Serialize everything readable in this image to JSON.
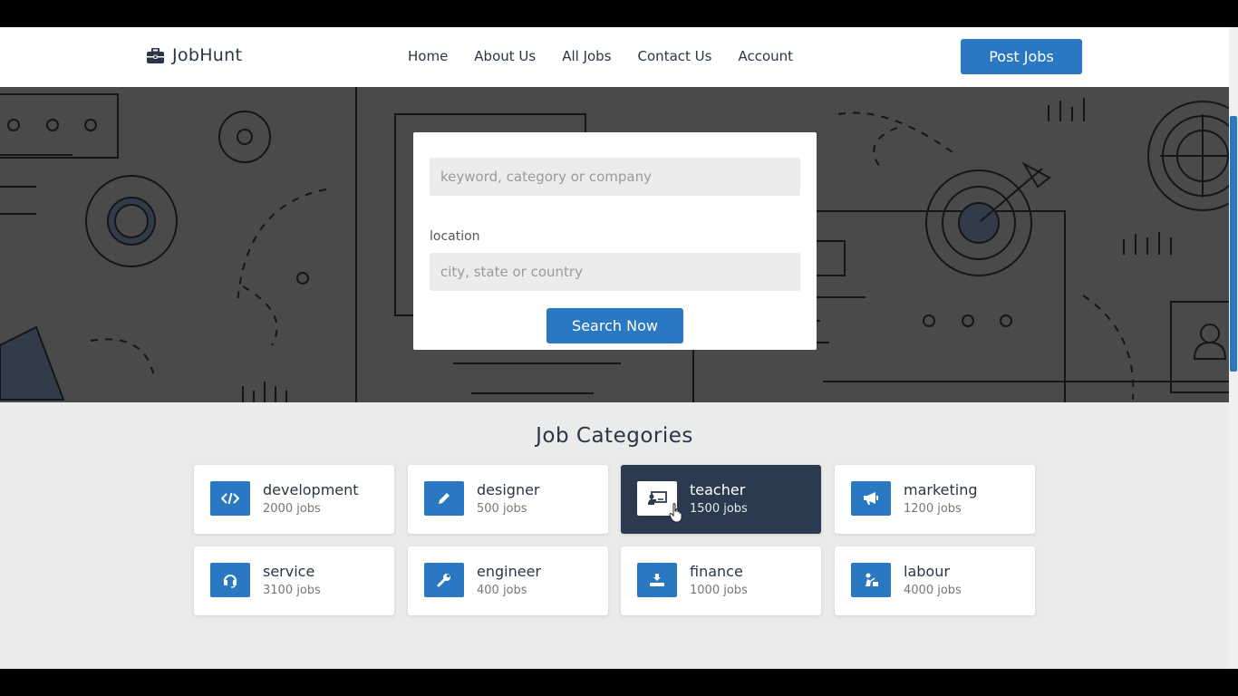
{
  "brand": {
    "name": "JobHunt",
    "icon": "briefcase-icon"
  },
  "nav": {
    "links": [
      "Home",
      "About Us",
      "All Jobs",
      "Contact Us",
      "Account"
    ],
    "post_button": "Post Jobs"
  },
  "search": {
    "keyword_placeholder": "keyword, category or company",
    "location_label": "location",
    "location_placeholder": "city, state or country",
    "button": "Search Now"
  },
  "categories": {
    "title": "Job Categories",
    "items": [
      {
        "name": "development",
        "count": "2000 jobs",
        "icon": "code-icon"
      },
      {
        "name": "designer",
        "count": "500 jobs",
        "icon": "pencil-icon"
      },
      {
        "name": "teacher",
        "count": "1500 jobs",
        "icon": "chalkboard-teacher-icon",
        "active": true
      },
      {
        "name": "marketing",
        "count": "1200 jobs",
        "icon": "megaphone-icon"
      },
      {
        "name": "service",
        "count": "3100 jobs",
        "icon": "headset-icon"
      },
      {
        "name": "engineer",
        "count": "400 jobs",
        "icon": "wrench-icon"
      },
      {
        "name": "finance",
        "count": "1000 jobs",
        "icon": "hand-coin-icon"
      },
      {
        "name": "labour",
        "count": "4000 jobs",
        "icon": "worker-icon"
      }
    ]
  },
  "colors": {
    "accent": "#2a78c2",
    "dark": "#2b3a4e",
    "hero_bg": "#4a4a4b",
    "page_bg": "#ebebea"
  }
}
